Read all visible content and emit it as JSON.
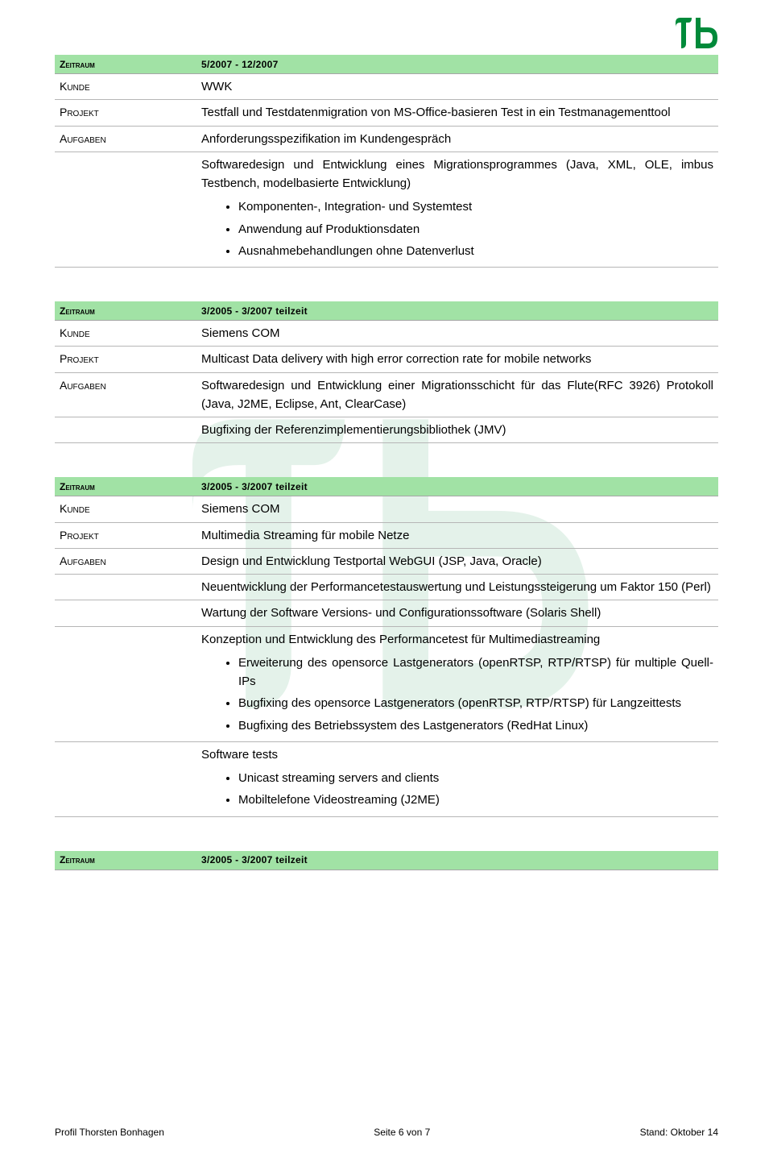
{
  "logo": {
    "name": "tb-logo"
  },
  "sections": [
    {
      "head_label": "Zeitraum",
      "head_value": "5/2007 - 12/2007",
      "rows": [
        {
          "label": "Kunde",
          "content": "WWK"
        },
        {
          "label": "Projekt",
          "content": "Testfall und Testdatenmigration von MS-Office-basieren Test in ein Testmanagementtool"
        },
        {
          "label": "Aufgaben",
          "content": "Anforderungsspezifikation im Kundengespräch"
        },
        {
          "label": "",
          "content": "Softwaredesign und Entwicklung eines Migrationsprogrammes (Java, XML, OLE, imbus Testbench, modelbasierte Entwicklung)",
          "bullets": [
            "Komponenten-, Integration- und Systemtest",
            "Anwendung auf Produktionsdaten",
            "Ausnahmebehandlungen ohne Datenverlust"
          ]
        }
      ]
    },
    {
      "head_label": "Zeitraum",
      "head_value": "3/2005 - 3/2007 teilzeit",
      "rows": [
        {
          "label": "Kunde",
          "content": "Siemens COM"
        },
        {
          "label": "Projekt",
          "content": "Multicast Data delivery with high error correction rate for mobile networks"
        },
        {
          "label": "Aufgaben",
          "content": "Softwaredesign und Entwicklung einer Migrationsschicht für das Flute(RFC 3926) Protokoll (Java, J2ME, Eclipse, Ant, ClearCase)"
        },
        {
          "label": "",
          "content": "Bugfixing der Referenzimplementierungsbibliothek (JMV)"
        }
      ]
    },
    {
      "head_label": "Zeitraum",
      "head_value": "3/2005 - 3/2007 teilzeit",
      "rows": [
        {
          "label": "Kunde",
          "content": "Siemens COM"
        },
        {
          "label": "Projekt",
          "content": "Multimedia Streaming für mobile Netze"
        },
        {
          "label": "Aufgaben",
          "content": "Design und Entwicklung Testportal WebGUI (JSP, Java, Oracle)"
        },
        {
          "label": "",
          "content": "Neuentwicklung der Performancetestauswertung und Leistungssteigerung um Faktor 150 (Perl)"
        },
        {
          "label": "",
          "content": "Wartung der Software Versions- und Configurationssoftware (Solaris Shell)"
        },
        {
          "label": "",
          "content": "Konzeption und Entwicklung des Performancetest für Multimediastreaming",
          "bullets": [
            "Erweiterung des opensorce Lastgenerators (openRTSP, RTP/RTSP) für multiple Quell-IPs",
            "Bugfixing des  opensorce Lastgenerators (openRTSP, RTP/RTSP) für Langzeittests",
            "Bugfixing des Betriebssystem des Lastgenerators (RedHat Linux)"
          ]
        },
        {
          "label": "",
          "content": "Software tests",
          "bullets": [
            "Unicast streaming servers and clients",
            "Mobiltelefone Videostreaming (J2ME)"
          ]
        }
      ]
    },
    {
      "head_label": "Zeitraum",
      "head_value": "3/2005 - 3/2007 teilzeit",
      "rows": []
    }
  ],
  "footer": {
    "left": "Profil Thorsten Bonhagen",
    "center": "Seite 6 von 7",
    "right": "Stand: Oktober 14"
  }
}
